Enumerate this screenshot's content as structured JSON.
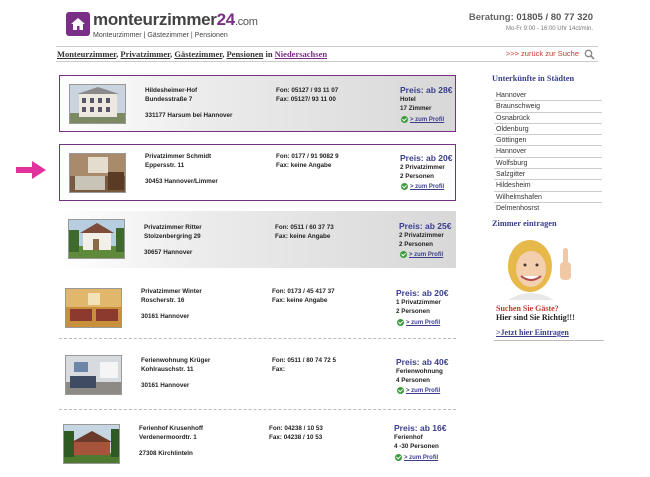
{
  "header": {
    "logo_main": "monteurzimmer",
    "logo_num": "24",
    "logo_dom": ".com",
    "logo_tagline": "Monteurzimmer | Gästezimmer | Pensionen",
    "hotline_label": "Beratung:",
    "hotline_number": "01805 / 80 77 320",
    "hotline_hours": "Mo-Fr 9:00 - 16:00 Uhr        14ct/min."
  },
  "breadcrumb": {
    "items": [
      "Monteurzimmer",
      "Privatzimmer",
      "Gästezimmer",
      "Pensionen"
    ],
    "connector": "in",
    "region": "Niedersachsen",
    "back_link": ">>> zurück zur Suche"
  },
  "listings": [
    {
      "name": "Hildesheimer-Hof",
      "street": "Bundesstraße 7",
      "city": "331177 Harsum bei Hannover",
      "fon": "Fon: 05127 / 93 11 07",
      "fax": "Fax: 05127/ 93 11 00",
      "price": "Preis: ab 28€",
      "type1": "Hotel",
      "type2": "17 Zimmer",
      "profil": "> zum Profil"
    },
    {
      "name": "Privatzimmer Schmidt",
      "street": "Eppersstr. 11",
      "city": "30453 Hannover/Limmer",
      "fon": "Fon: 0177 / 91 9082 9",
      "fax": "Fax: keine Angabe",
      "price": "Preis: ab 20€",
      "type1": "2 Privatzimmer",
      "type2": "2 Personen",
      "profil": "> zum Profil"
    },
    {
      "name": "Privatzimmer Ritter",
      "street": "Stolzenbergring 29",
      "city": "30657 Hannover",
      "fon": "Fon: 0511 / 60 37 73",
      "fax": "Fax: keine Angabe",
      "price": "Preis: ab 25€",
      "type1": "2 Privatzimmer",
      "type2": "2 Personen",
      "profil": "> zum Profil"
    },
    {
      "name": "Privatzimmer Winter",
      "street": "Roscherstr. 16",
      "city": "30161 Hannover",
      "fon": "Fon: 0173 / 45 417 37",
      "fax": "Fax: keine Angabe",
      "price": "Preis: ab 20€",
      "type1": "1 Privatzimmer",
      "type2": "2 Personen",
      "profil": "> zum Profil"
    },
    {
      "name": "Ferienwohnung Krüger",
      "street": "Kohlrauschstr. 11",
      "city": "30161 Hannover",
      "fon": "Fon: 0511 / 80 74 72 5",
      "fax": "Fax:",
      "price": "Preis: ab 40€",
      "type1": "Ferienwohnung",
      "type2": "4 Personen",
      "profil": "> zum Profil"
    },
    {
      "name": "Ferienhof Krusenhoff",
      "street": "Verdenermoordtr. 1",
      "city": "27308 Kirchlinteln",
      "fon": "Fon: 04238 / 10 53",
      "fax": "Fax: 04238 / 10 53",
      "price": "Preis: ab 16€",
      "type1": "Ferienhof",
      "type2": "4 -30 Personen",
      "profil": "> zum Profil"
    }
  ],
  "sidebar": {
    "cities_title": "Unterkünfte in Städten",
    "cities": [
      "Hannover",
      "Braunschweig",
      "Osnabrück",
      "Oldenburg",
      "Göttingen",
      "Hannover",
      "Wolfsburg",
      "Salzgitter",
      "Hildesheim",
      "Wilhelmshafen",
      "Delmenhosrst"
    ],
    "eintragen_title": "Zimmer eintragen",
    "question": "Suchen Sie Gäste?",
    "answer": "Hier sind Sie Richtig!!!",
    "cta": ">Jetzt hier Eintragen"
  },
  "colors": {
    "brand": "#7a2f86",
    "link": "#3a3e8c",
    "alert": "#c0392b",
    "pointer": "#e0319c"
  }
}
